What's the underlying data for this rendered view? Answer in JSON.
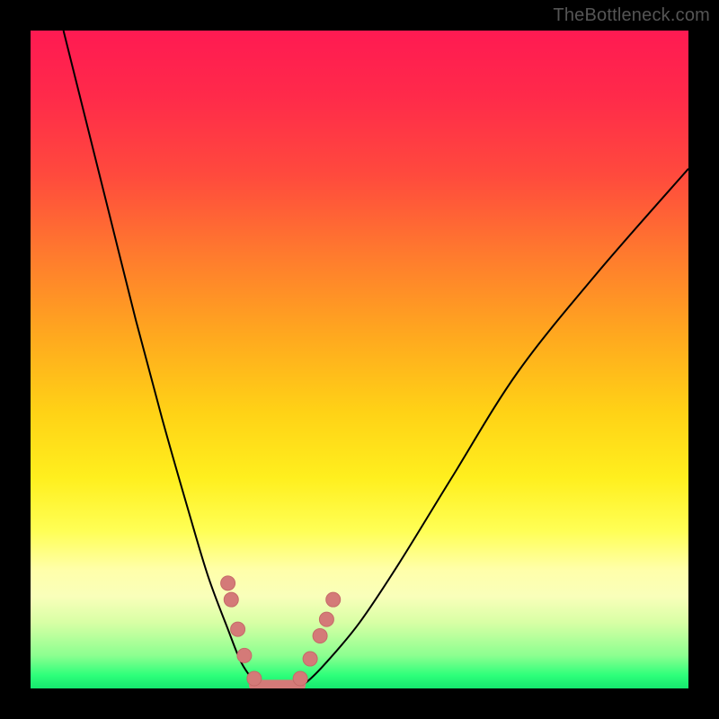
{
  "watermark": "TheBottleneck.com",
  "chart_data": {
    "type": "line",
    "title": "",
    "xlabel": "",
    "ylabel": "",
    "xlim": [
      0,
      100
    ],
    "ylim": [
      0,
      100
    ],
    "series": [
      {
        "name": "left-curve",
        "x": [
          5,
          8,
          12,
          16,
          20,
          24,
          27,
          30,
          32,
          34,
          35
        ],
        "y": [
          100,
          88,
          72,
          56,
          41,
          27,
          17,
          9,
          4,
          1,
          0
        ]
      },
      {
        "name": "right-curve",
        "x": [
          40,
          42,
          45,
          50,
          56,
          64,
          74,
          86,
          100
        ],
        "y": [
          0,
          1,
          4,
          10,
          19,
          32,
          48,
          63,
          79
        ]
      }
    ],
    "markers": {
      "name": "highlight-dots",
      "points": [
        {
          "x": 30.0,
          "y": 16.0
        },
        {
          "x": 30.5,
          "y": 13.5
        },
        {
          "x": 31.5,
          "y": 9.0
        },
        {
          "x": 32.5,
          "y": 5.0
        },
        {
          "x": 34.0,
          "y": 1.5
        },
        {
          "x": 41.0,
          "y": 1.5
        },
        {
          "x": 42.5,
          "y": 4.5
        },
        {
          "x": 44.0,
          "y": 8.0
        },
        {
          "x": 45.0,
          "y": 10.5
        },
        {
          "x": 46.0,
          "y": 13.5
        }
      ],
      "bottom_segment": {
        "x1": 34.0,
        "x2": 41.0,
        "y": 0.5
      }
    },
    "colors": {
      "curve": "#000000",
      "marker_fill": "#d47a78",
      "gradient_top": "#ff1a52",
      "gradient_bottom": "#15e86e"
    }
  }
}
